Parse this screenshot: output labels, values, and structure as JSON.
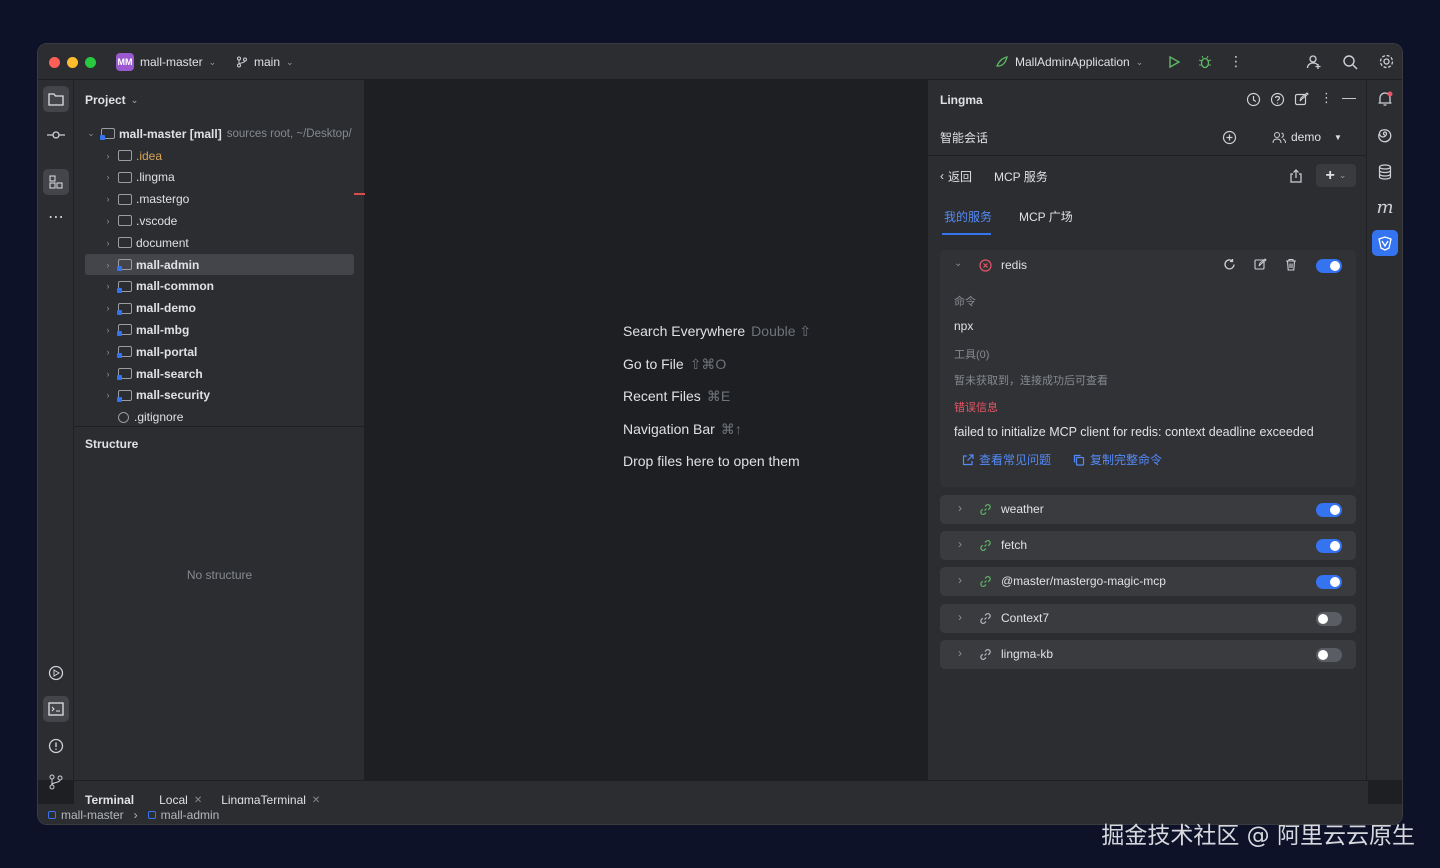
{
  "titlebar": {
    "project_badge": "MM",
    "project_name": "mall-master",
    "branch": "main",
    "run_config": "MallAdminApplication"
  },
  "project_panel": {
    "title": "Project",
    "root_name": "mall-master [mall]",
    "root_meta": "sources root, ~/Desktop/",
    "items": [
      {
        "label": ".idea",
        "bold": false
      },
      {
        "label": ".lingma",
        "bold": false
      },
      {
        "label": ".mastergo",
        "bold": false
      },
      {
        "label": ".vscode",
        "bold": false
      },
      {
        "label": "document",
        "bold": false
      },
      {
        "label": "mall-admin",
        "bold": true
      },
      {
        "label": "mall-common",
        "bold": true
      },
      {
        "label": "mall-demo",
        "bold": true
      },
      {
        "label": "mall-mbg",
        "bold": true
      },
      {
        "label": "mall-portal",
        "bold": true
      },
      {
        "label": "mall-search",
        "bold": true
      },
      {
        "label": "mall-security",
        "bold": true
      },
      {
        "label": ".gitignore",
        "bold": false
      }
    ],
    "structure_title": "Structure",
    "no_structure": "No structure"
  },
  "editor_hints": [
    {
      "label": "Search Everywhere",
      "key": "Double ⇧"
    },
    {
      "label": "Go to File",
      "key": "⇧⌘O"
    },
    {
      "label": "Recent Files",
      "key": "⌘E"
    },
    {
      "label": "Navigation Bar",
      "key": "⌘↑"
    },
    {
      "label": "Drop files here to open them",
      "key": ""
    }
  ],
  "lingma": {
    "title": "Lingma",
    "session_label": "智能会话",
    "user": "demo",
    "back_label": "返回",
    "page_title": "MCP 服务",
    "tabs": [
      "我的服务",
      "MCP 广场"
    ],
    "redis": {
      "name": "redis",
      "command_label": "命令",
      "command": "npx",
      "tools_label": "工具(0)",
      "tools_hint": "暂未获取到，连接成功后可查看",
      "error_label": "错误信息",
      "error": "failed to initialize MCP client for redis: context deadline exceeded",
      "faq_link": "查看常见问题",
      "copy_link": "复制完整命令",
      "enabled": true
    },
    "services": [
      {
        "name": "weather",
        "enabled": true
      },
      {
        "name": "fetch",
        "enabled": true
      },
      {
        "name": "@master/mastergo-magic-mcp",
        "enabled": true
      },
      {
        "name": "Context7",
        "enabled": false
      },
      {
        "name": "lingma-kb",
        "enabled": false
      }
    ]
  },
  "bottom": {
    "tabs": [
      "Terminal",
      "Local",
      "LingmaTerminal"
    ],
    "breadcrumb": [
      "mall-master",
      "mall-admin"
    ]
  },
  "watermark": "掘金技术社区 @ 阿里云云原生",
  "colors": {
    "accent": "#3574f0",
    "error": "#e55765",
    "bg": "#1e1f22",
    "panel": "#2b2d30"
  }
}
